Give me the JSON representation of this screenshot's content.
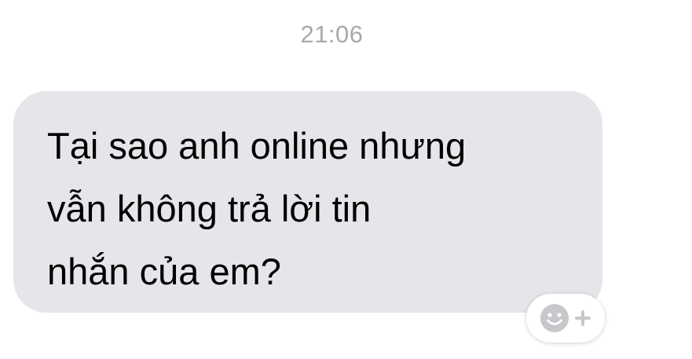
{
  "conversation": {
    "timestamp": "21:06",
    "messages": [
      {
        "direction": "incoming",
        "text": "Tại sao anh online nhưng\nvẫn không trả lời tin\nnhắn của em?"
      }
    ]
  },
  "reaction": {
    "icon": "smiley-add-icon",
    "color": "#c7c7cc"
  },
  "colors": {
    "bubble": "#e6e6ea",
    "timestamp": "#a9a9ad"
  }
}
